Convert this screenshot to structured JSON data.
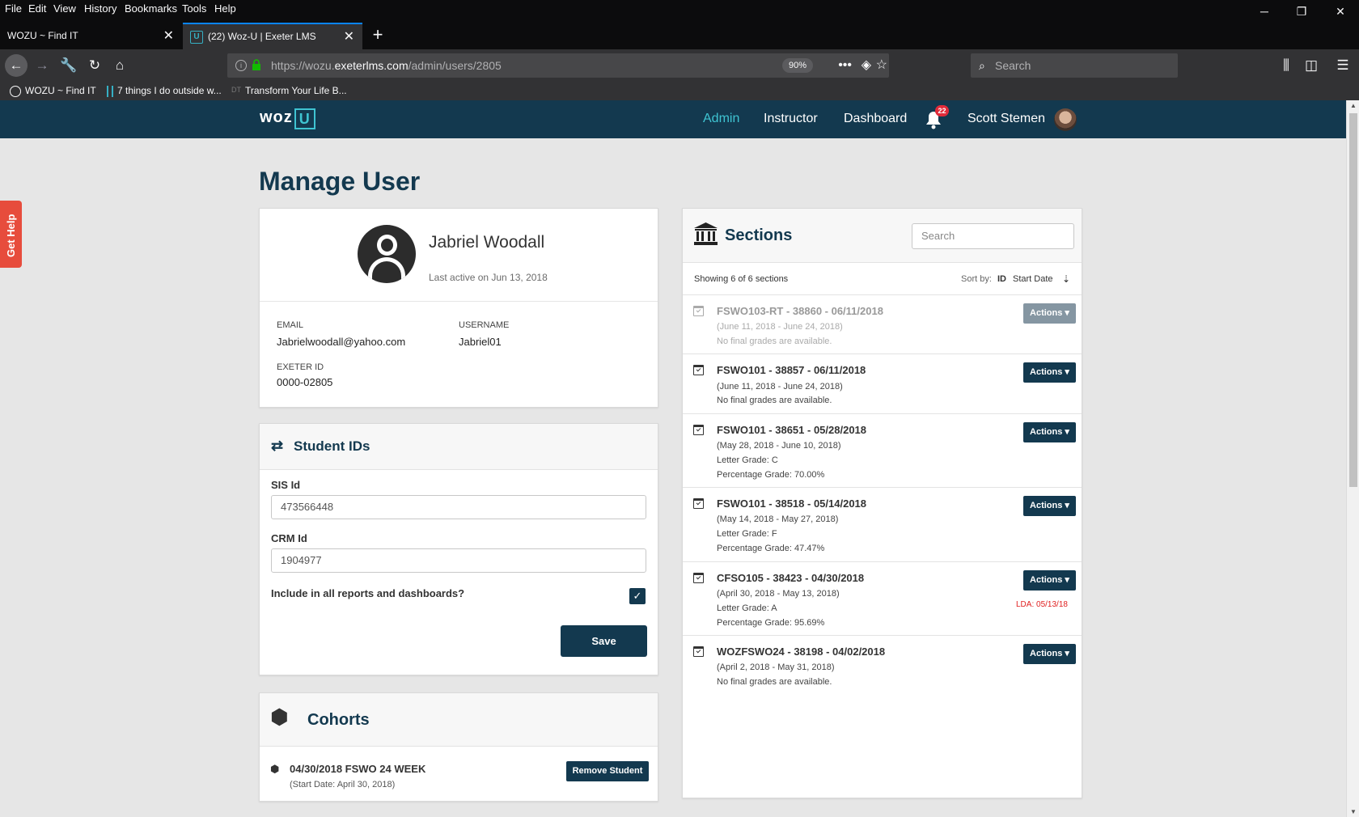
{
  "browser": {
    "menu": [
      "File",
      "Edit",
      "View",
      "History",
      "Bookmarks",
      "Tools",
      "Help"
    ],
    "tabs": [
      {
        "title": "WOZU ~ Find IT",
        "active": false
      },
      {
        "title": "(22) Woz-U | Exeter LMS",
        "active": true,
        "favicon": "U"
      }
    ],
    "new_tab": "+",
    "url_prefix": "https://wozu.",
    "url_domain": "exeterlms.com",
    "url_path": "/admin/users/2805",
    "zoom": "90%",
    "search_placeholder": "Search",
    "bookmarks": [
      "WOZU ~ Find IT",
      "7 things I do outside w...",
      "Transform Your Life B..."
    ],
    "bookmark_dt": "DT"
  },
  "header": {
    "logo_text": "woz",
    "logo_u": "U",
    "nav": [
      "Admin",
      "Instructor",
      "Dashboard"
    ],
    "active_nav": "Admin",
    "notifications": "22",
    "user_name": "Scott Stemen",
    "accent": "#3fc4d2",
    "brand": "#13394f"
  },
  "get_help": "Get Help",
  "page_title": "Manage User",
  "profile": {
    "name": "Jabriel Woodall",
    "last_active": "Last active on Jun 13, 2018",
    "email_label": "EMAIL",
    "email": "Jabrielwoodall@yahoo.com",
    "username_label": "USERNAME",
    "username": "Jabriel01",
    "exeter_label": "EXETER ID",
    "exeter_id": "0000-02805"
  },
  "student_ids": {
    "title": "Student IDs",
    "sis_label": "SIS Id",
    "sis_value": "473566448",
    "crm_label": "CRM Id",
    "crm_value": "1904977",
    "include_label": "Include in all reports and dashboards?",
    "include_checked": true,
    "save_label": "Save"
  },
  "cohorts": {
    "title": "Cohorts",
    "items": [
      {
        "name": "04/30/2018 FSWO 24 WEEK",
        "start": "(Start Date: April 30, 2018)",
        "remove_label": "Remove Student"
      }
    ]
  },
  "sections": {
    "title": "Sections",
    "search_placeholder": "Search",
    "showing": "Showing 6 of 6 sections",
    "sort_by": "Sort by:",
    "sort_id": "ID",
    "sort_start": "Start Date",
    "actions_label": "Actions ▾",
    "items": [
      {
        "title": "FSWO103-RT - 38860 - 06/11/2018",
        "lines": [
          "(June 11, 2018 - June 24, 2018)",
          "No final grades are available."
        ],
        "dim": true
      },
      {
        "title": "FSWO101 - 38857 - 06/11/2018",
        "lines": [
          "(June 11, 2018 - June 24, 2018)",
          "No final grades are available."
        ],
        "dim": false
      },
      {
        "title": "FSWO101 - 38651 - 05/28/2018",
        "lines": [
          "(May 28, 2018 - June 10, 2018)",
          "Letter Grade: C",
          "Percentage Grade: 70.00%"
        ],
        "dim": false
      },
      {
        "title": "FSWO101 - 38518 - 05/14/2018",
        "lines": [
          "(May 14, 2018 - May 27, 2018)",
          "Letter Grade: F",
          "Percentage Grade: 47.47%"
        ],
        "dim": false
      },
      {
        "title": "CFSO105 - 38423 - 04/30/2018",
        "lines": [
          "(April 30, 2018 - May 13, 2018)",
          "Letter Grade: A",
          "Percentage Grade: 95.69%"
        ],
        "dim": false,
        "lda": "LDA: 05/13/18"
      },
      {
        "title": "WOZFSWO24 - 38198 - 04/02/2018",
        "lines": [
          "(April 2, 2018 - May 31, 2018)",
          "No final grades are available."
        ],
        "dim": false
      }
    ]
  }
}
